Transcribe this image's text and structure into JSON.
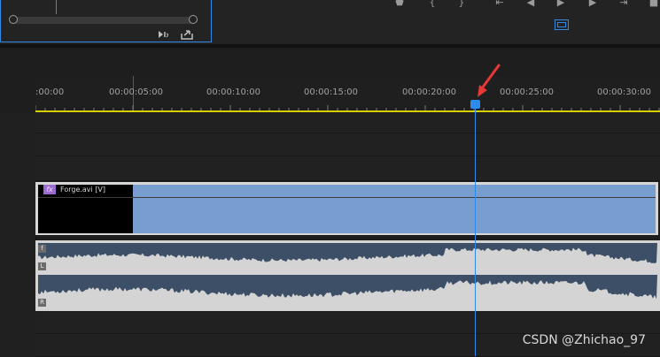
{
  "source_monitor": {
    "export_frame_icon": "camera-export-icon",
    "export_clip_icon": "export-clip-icon"
  },
  "program_transport": {
    "buttons": [
      "marker-icon",
      "in-point-icon",
      "out-point-icon",
      "go-to-in-icon",
      "step-back-icon",
      "play-icon",
      "step-forward-icon",
      "go-to-out-icon",
      "insert-icon"
    ],
    "safe_margins_icon": "safe-margins-icon"
  },
  "timeline": {
    "timecodes": [
      ":00:00",
      "00:00:05:00",
      "00:00:10:00",
      "00:00:15:00",
      "00:00:20:00",
      "00:00:25:00",
      "00:00:30:00"
    ],
    "video_clip": {
      "fx_badge": "fx",
      "name": "Forge.avi [V]"
    },
    "audio_channels": [
      "L",
      "R"
    ],
    "playhead_color": "#2d8ceb",
    "work_area_color": "#d8d000",
    "clip_color": "#779ecf"
  },
  "annotation": {
    "arrow_color": "#e53935"
  },
  "watermark": "CSDN @Zhichao_97"
}
